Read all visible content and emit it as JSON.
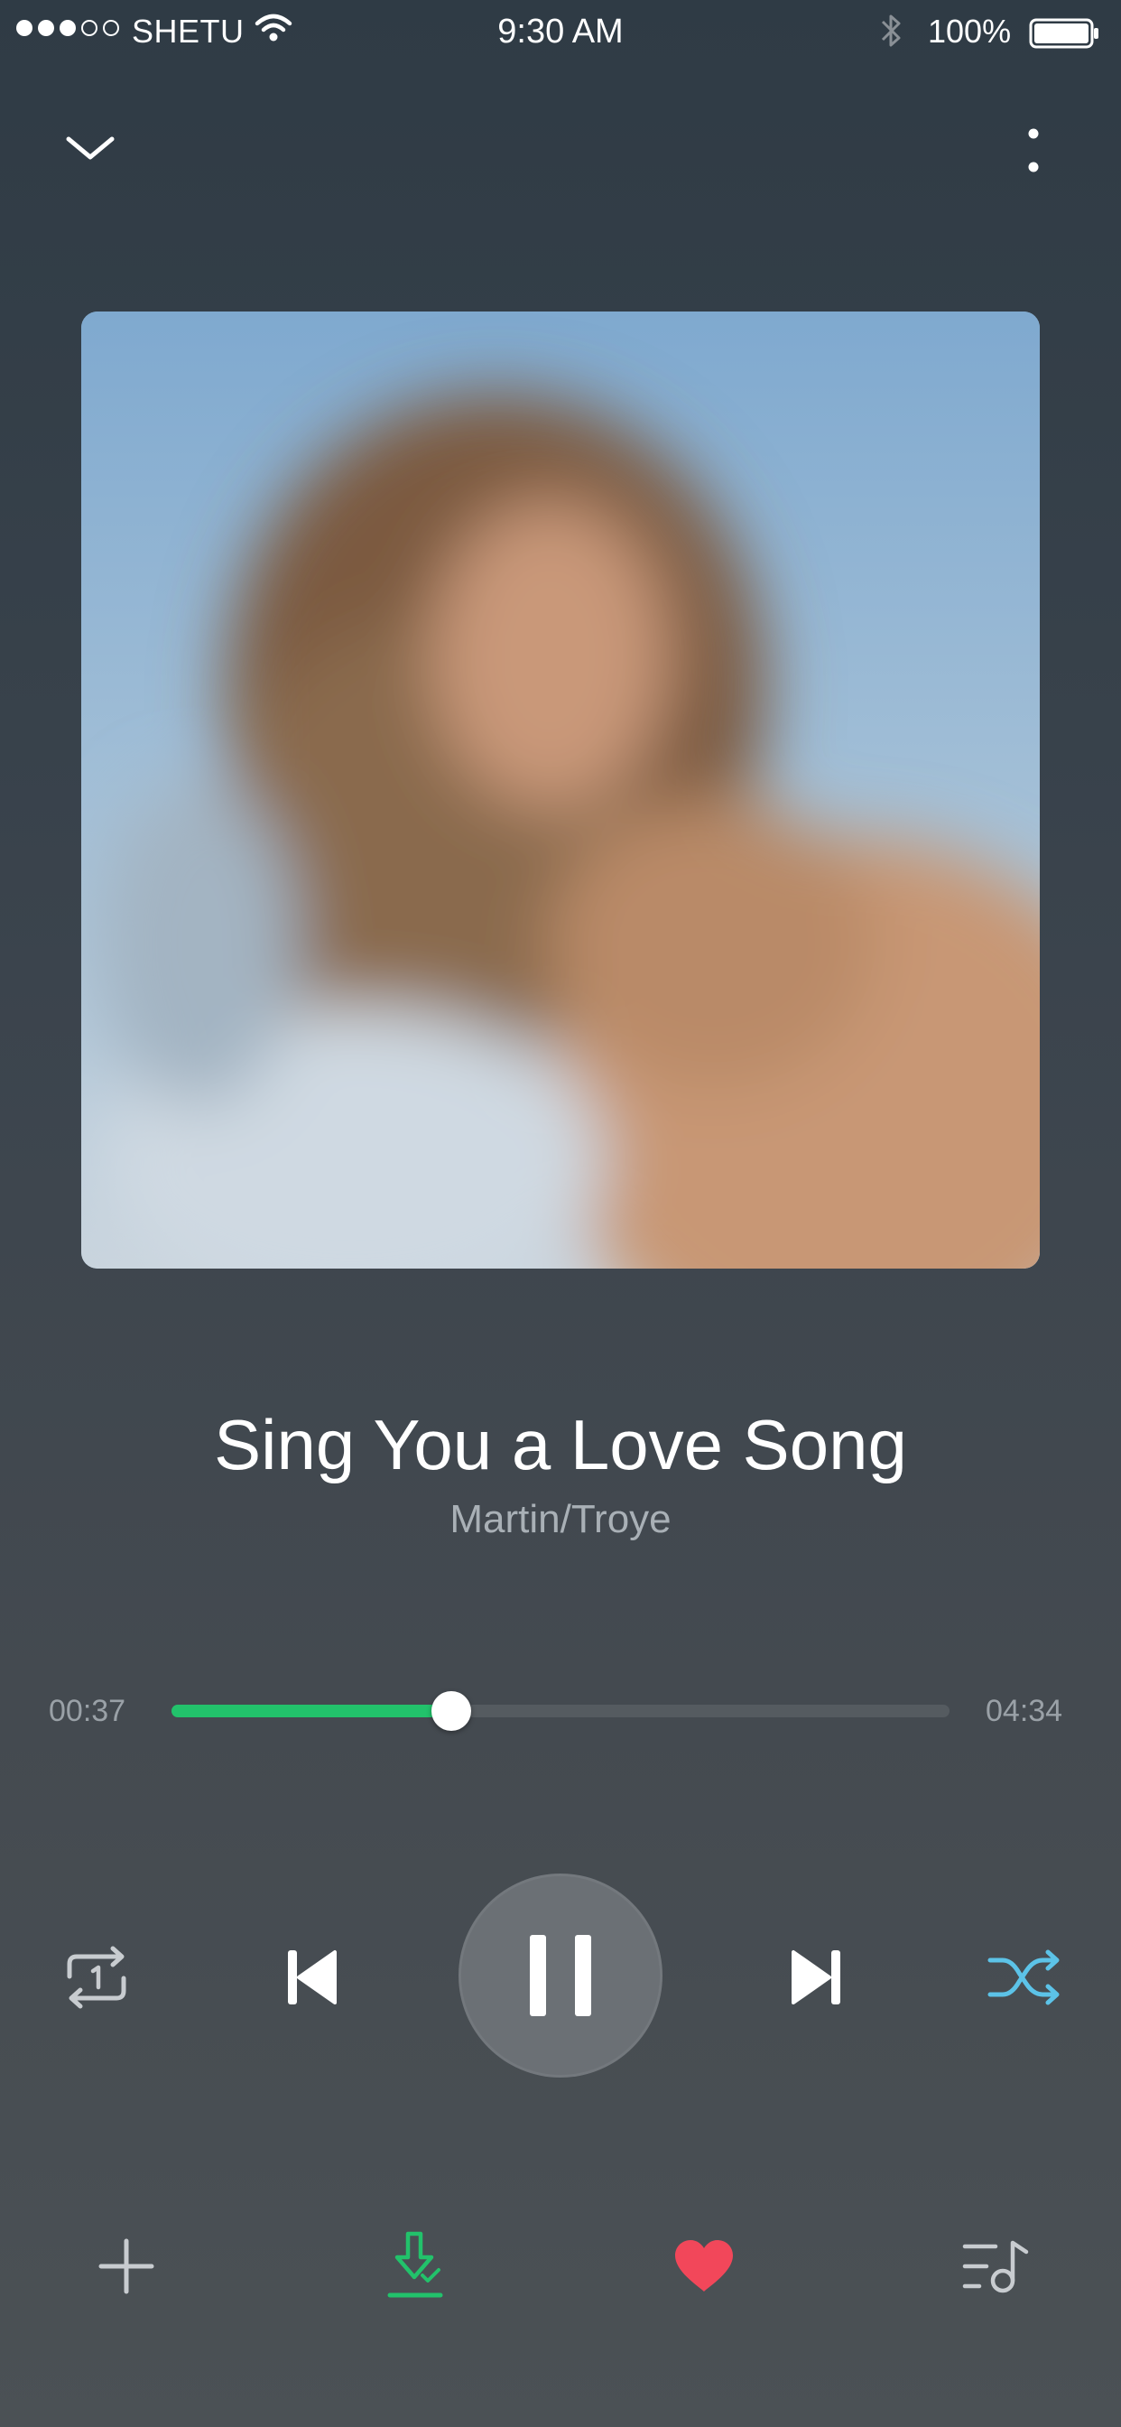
{
  "status_bar": {
    "carrier": "SHETU",
    "time": "9:30 AM",
    "battery": "100%",
    "signal_full": 3,
    "signal_total": 5
  },
  "header": {
    "collapse_icon": "chevron-down-icon",
    "more_icon": "more-vertical-icon"
  },
  "track": {
    "title": "Sing You a Love Song",
    "artist": "Martin/Troye"
  },
  "progress": {
    "current": "00:37",
    "total": "04:34",
    "fraction": 0.36
  },
  "controls": {
    "repeat_icon": "repeat-one-icon",
    "prev_icon": "skip-previous-icon",
    "pause_icon": "pause-icon",
    "next_icon": "skip-next-icon",
    "shuffle_icon": "shuffle-icon"
  },
  "actions": {
    "add_icon": "plus-icon",
    "download_icon": "download-icon",
    "like_icon": "heart-icon",
    "playlist_icon": "playlist-icon"
  },
  "colors": {
    "accent_green": "#22c26b",
    "shuffle_blue": "#5cc3e8",
    "heart_red": "#f2475a"
  }
}
